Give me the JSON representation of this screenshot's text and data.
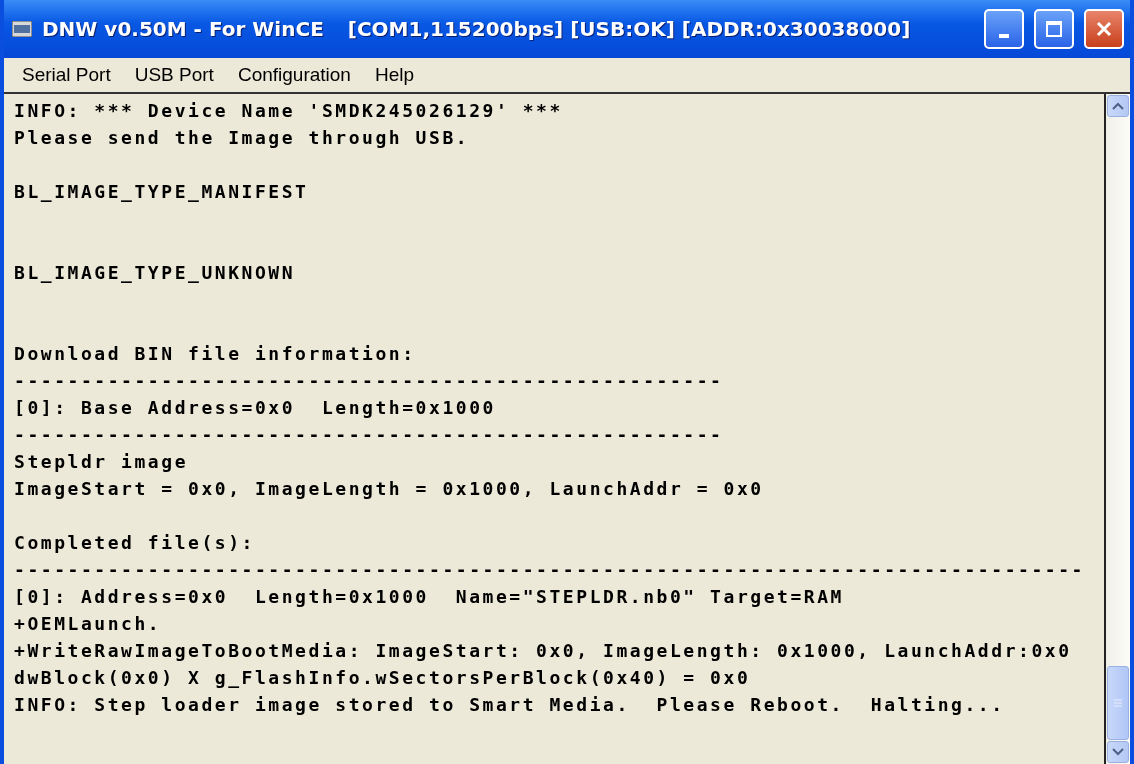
{
  "window": {
    "title": "DNW v0.50M - For WinCE",
    "status": "[COM1,115200bps] [USB:OK] [ADDR:0x30038000]"
  },
  "menu": [
    "Serial Port",
    "USB Port",
    "Configuration",
    "Help"
  ],
  "console_lines": [
    {
      "kind": "text",
      "text": "INFO: *** Device Name 'SMDK245026129' ***"
    },
    {
      "kind": "text",
      "text": "Please send the Image through USB."
    },
    {
      "kind": "blank"
    },
    {
      "kind": "text",
      "text": "BL_IMAGE_TYPE_MANIFEST"
    },
    {
      "kind": "blank"
    },
    {
      "kind": "blank"
    },
    {
      "kind": "text",
      "text": "BL_IMAGE_TYPE_UNKNOWN"
    },
    {
      "kind": "blank"
    },
    {
      "kind": "blank"
    },
    {
      "kind": "text",
      "text": "Download BIN file information:"
    },
    {
      "kind": "text",
      "text": "-----------------------------------------------------"
    },
    {
      "kind": "text",
      "text": "[0]: Base Address=0x0  Length=0x1000"
    },
    {
      "kind": "text",
      "text": "-----------------------------------------------------"
    },
    {
      "kind": "text",
      "text": "Stepldr image"
    },
    {
      "kind": "text",
      "text": "ImageStart = 0x0, ImageLength = 0x1000, LaunchAddr = 0x0"
    },
    {
      "kind": "blank"
    },
    {
      "kind": "text",
      "text": "Completed file(s):"
    },
    {
      "kind": "text",
      "text": "--------------------------------------------------------------------------------"
    },
    {
      "kind": "text",
      "text": "[0]: Address=0x0  Length=0x1000  Name=\"STEPLDR.nb0\" Target=RAM"
    },
    {
      "kind": "text",
      "text": "+OEMLaunch."
    },
    {
      "kind": "text",
      "text": "+WriteRawImageToBootMedia: ImageStart: 0x0, ImageLength: 0x1000, LaunchAddr:0x0"
    },
    {
      "kind": "text",
      "text": "dwBlock(0x0) X g_FlashInfo.wSectorsPerBlock(0x40) = 0x0"
    },
    {
      "kind": "text",
      "text": "INFO: Step loader image stored to Smart Media.  Please Reboot.  Halting..."
    }
  ]
}
